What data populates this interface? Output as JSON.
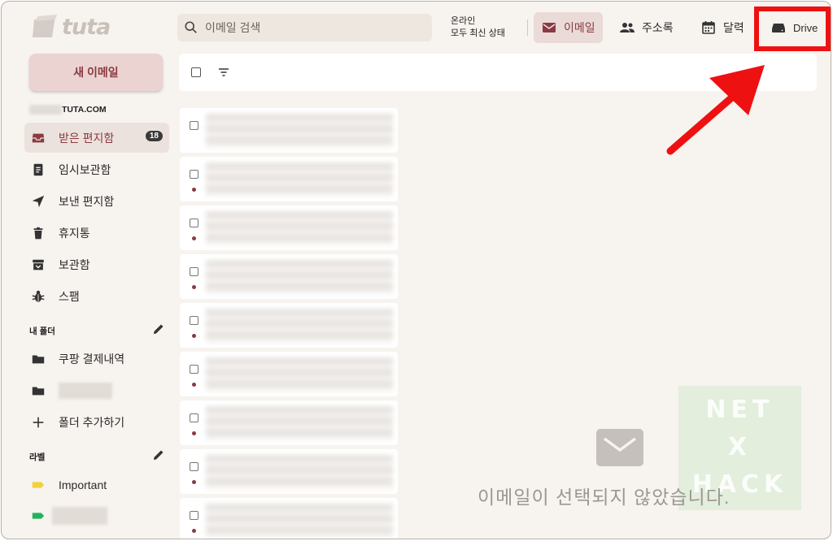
{
  "app": {
    "logo_text": "tuta"
  },
  "search": {
    "placeholder": "이메일 검색"
  },
  "status": {
    "line1": "온라인",
    "line2": "모두 최신 상태"
  },
  "nav": {
    "email": "이메일",
    "contacts": "주소록",
    "calendar": "달력",
    "drive": "Drive"
  },
  "sidebar": {
    "compose": "새 이메일",
    "account_suffix": "TUTA.COM",
    "items": [
      {
        "label": "받은 편지함",
        "badge": "18",
        "icon": "inbox-icon"
      },
      {
        "label": "임시보관함",
        "icon": "draft-icon"
      },
      {
        "label": "보낸 편지함",
        "icon": "send-icon"
      },
      {
        "label": "휴지통",
        "icon": "trash-icon"
      },
      {
        "label": "보관함",
        "icon": "archive-icon"
      },
      {
        "label": "스팸",
        "icon": "bug-icon"
      }
    ],
    "folders_heading": "내 폴더",
    "folders": [
      {
        "label": "쿠팡 결제내역",
        "icon": "folder-icon"
      }
    ],
    "add_folder": "폴더 추가하기",
    "labels_heading": "라벨",
    "labels": [
      {
        "label": "Important",
        "color": "#f2d13a"
      }
    ],
    "label2_color": "#22b35a"
  },
  "main": {
    "empty_message": "이메일이 선택되지 않았습니다."
  },
  "watermark": {
    "line1": "NET",
    "line2": "X",
    "line3": "HACK"
  },
  "colors": {
    "accent": "#8b3a40",
    "highlight": "#ee1111"
  }
}
